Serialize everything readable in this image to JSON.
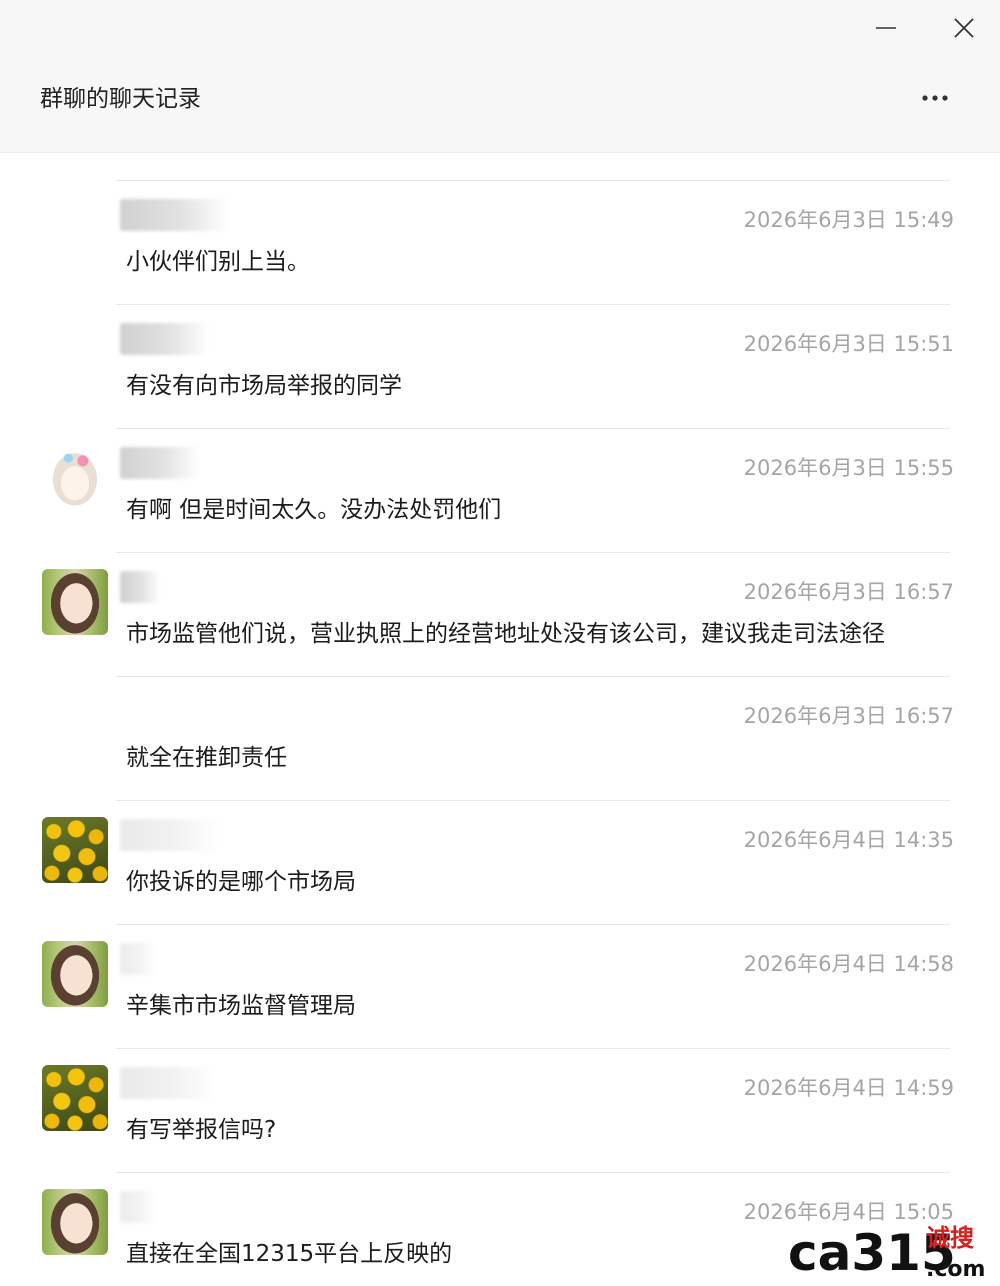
{
  "window": {
    "title": "群聊的聊天记录",
    "minimize_icon": "minimize-icon",
    "close_icon": "close-icon",
    "more_icon": "more-icon"
  },
  "messages": [
    {
      "avatar": "none",
      "time": "2026年6月3日 15:49",
      "text": "小伙伴们别上当。"
    },
    {
      "avatar": "none",
      "time": "2026年6月3日 15:51",
      "text": "有没有向市场局举报的同学"
    },
    {
      "avatar": "cartoon-girl",
      "time": "2026年6月3日 15:55",
      "text": "有啊  但是时间太久。没办法处罚他们"
    },
    {
      "avatar": "girl-photo",
      "time": "2026年6月3日 16:57",
      "text": "市场监管他们说，营业执照上的经营地址处没有该公司，建议我走司法途径"
    },
    {
      "avatar": "none",
      "time": "2026年6月3日 16:57",
      "text": "就全在推卸责任"
    },
    {
      "avatar": "yellow-flowers",
      "time": "2026年6月4日 14:35",
      "text": "你投诉的是哪个市场局"
    },
    {
      "avatar": "girl-photo",
      "time": "2026年6月4日 14:58",
      "text": "辛集市市场监督管理局"
    },
    {
      "avatar": "yellow-flowers",
      "time": "2026年6月4日 14:59",
      "text": "有写举报信吗?"
    },
    {
      "avatar": "girl-photo",
      "time": "2026年6月4日 15:05",
      "text": "直接在全国12315平台上反映的"
    }
  ],
  "watermark": {
    "logo_text": "ca315",
    "brand_top": "诚搜",
    "brand_bottom": ".com"
  }
}
